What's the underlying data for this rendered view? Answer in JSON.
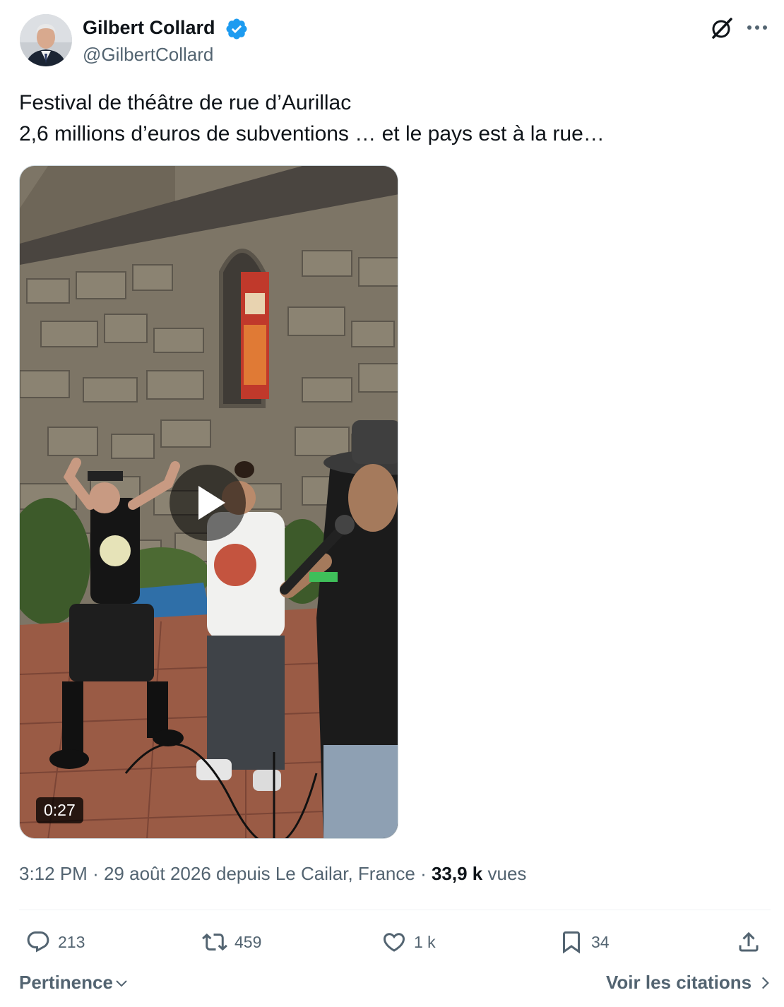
{
  "tweet": {
    "author_name": "Gilbert Collard",
    "handle": "@GilbertCollard",
    "verified": true,
    "text_lines": [
      "Festival de théâtre de rue d’Aurillac",
      "2,6 millions d’euros de subventions … et le pays est à la rue…"
    ],
    "media": {
      "type": "video",
      "duration": "0:27"
    },
    "meta": {
      "time": "3:12 PM",
      "separator": "·",
      "date_location": "29 août 2026 depuis Le Cailar, France",
      "views_count": "33,9 k",
      "views_label": "vues"
    }
  },
  "actions": {
    "replies": "213",
    "reposts": "459",
    "likes": "1 k",
    "bookmarks": "34"
  },
  "footer": {
    "sort_label": "Pertinence",
    "quotes_label": "Voir les citations"
  },
  "icons": [
    "verified-badge-icon",
    "grok-icon",
    "more-icon",
    "reply-icon",
    "repost-icon",
    "like-icon",
    "bookmark-icon",
    "share-icon",
    "chevron-down-icon",
    "chevron-right-icon",
    "play-icon"
  ],
  "colors": {
    "accent": "#1d9bf0",
    "text": "#0f1419",
    "muted": "#536471"
  }
}
